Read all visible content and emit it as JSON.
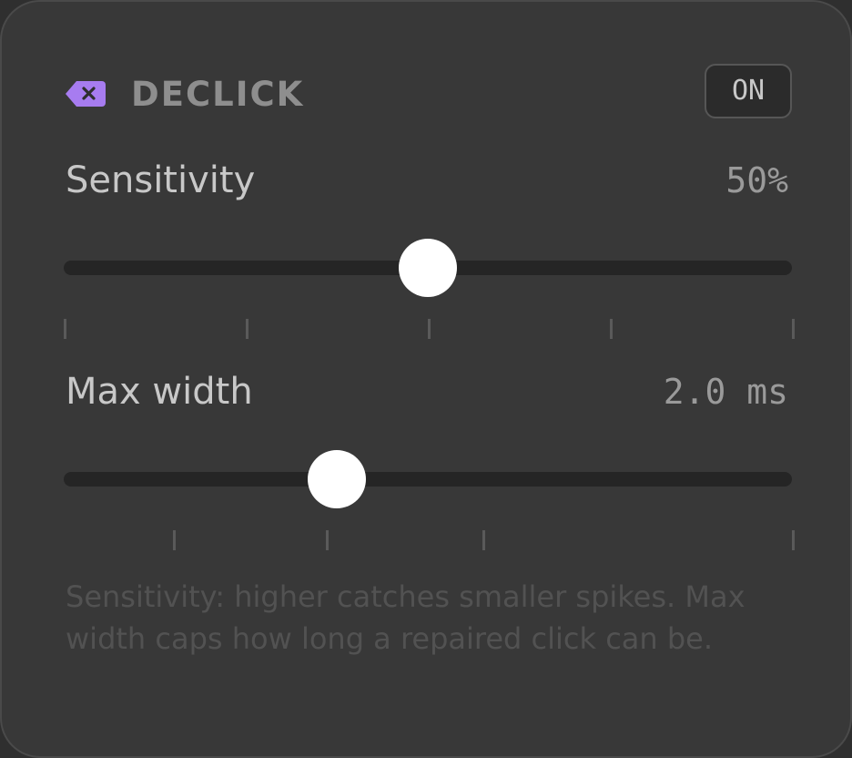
{
  "header": {
    "title": "DECLICK",
    "icon": "tag-close-icon",
    "toggle_label": "ON"
  },
  "sensitivity": {
    "label": "Sensitivity",
    "value_text": "50%",
    "value": 0.5
  },
  "max_width": {
    "label": "Max width",
    "value_text": "2.0 ms",
    "value": 0.375
  },
  "help_text": "Sensitivity: higher catches smaller spikes. Max width caps how long a repaired click can be.",
  "colors": {
    "accent": "#a77cf0",
    "panel": "#383838",
    "track": "#252525",
    "thumb": "#ffffff"
  }
}
